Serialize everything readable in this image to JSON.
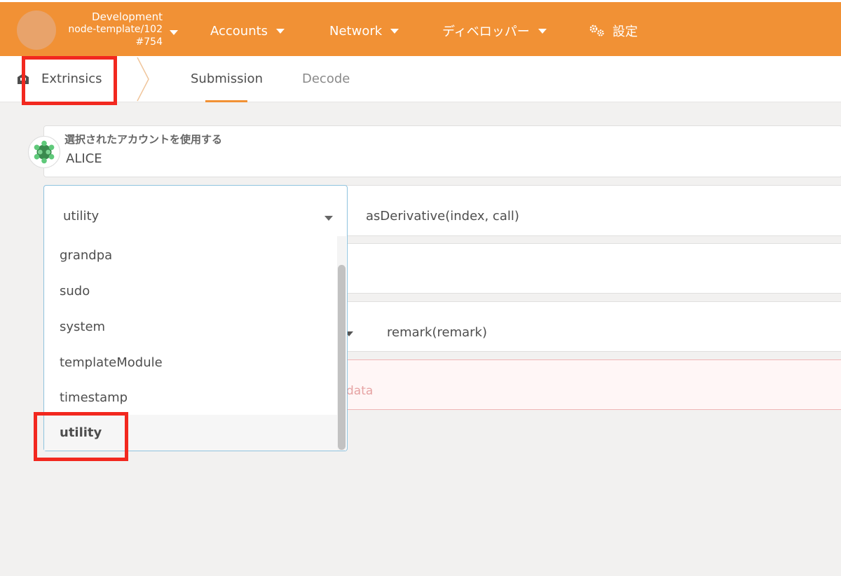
{
  "topbar": {
    "chain_name": "Development",
    "node_version": "node-template/102",
    "block_number": "#754",
    "nav": [
      {
        "label": "Accounts",
        "icon": "chevron-down-icon"
      },
      {
        "label": "Network",
        "icon": "chevron-down-icon"
      },
      {
        "label": "ディベロッパー",
        "icon": "chevron-down-icon"
      },
      {
        "label": "設定",
        "icon": "gears-icon"
      }
    ],
    "accent_color": "#f19135"
  },
  "tabs": {
    "section_label": "Extrinsics",
    "section_icon": "extrinsics-icon",
    "items": [
      {
        "label": "Submission",
        "active": true
      },
      {
        "label": "Decode",
        "active": false
      }
    ]
  },
  "account": {
    "label": "選択されたアカウントを使用する",
    "value": "ALICE"
  },
  "extrinsic": {
    "module_value": "utility",
    "method_value": "asDerivative(index, call)",
    "inner_method_value": "remark(remark)",
    "remark_hint": "data"
  },
  "dropdown": {
    "options": [
      "grandpa",
      "sudo",
      "system",
      "templateModule",
      "timestamp",
      "utility"
    ],
    "selected": "utility"
  }
}
